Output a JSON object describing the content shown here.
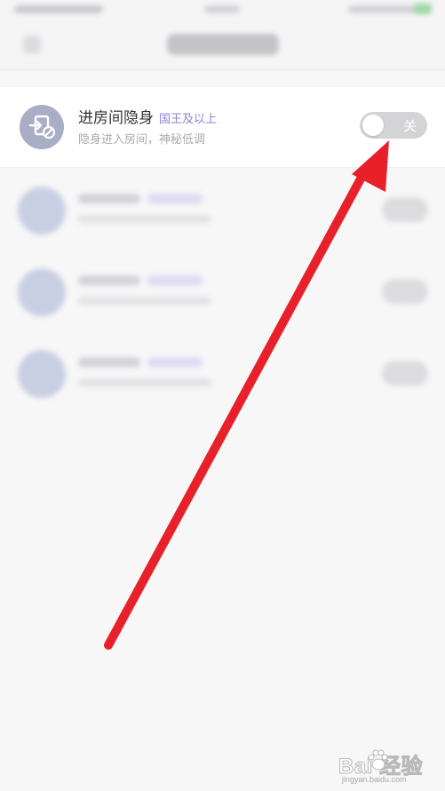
{
  "setting": {
    "title": "进房间隐身",
    "badge": "国王及以上",
    "subtitle": "隐身进入房间，神秘低调",
    "toggle_text": "关",
    "toggle_state": "off"
  },
  "watermark": {
    "brand": "Bai  经验",
    "url": "jingyan.baidu.com"
  },
  "colors": {
    "badge": "#8a84d0",
    "icon_bg": "#a9aec6",
    "toggle_off": "#d4d4d6",
    "arrow": "#e8202a"
  }
}
